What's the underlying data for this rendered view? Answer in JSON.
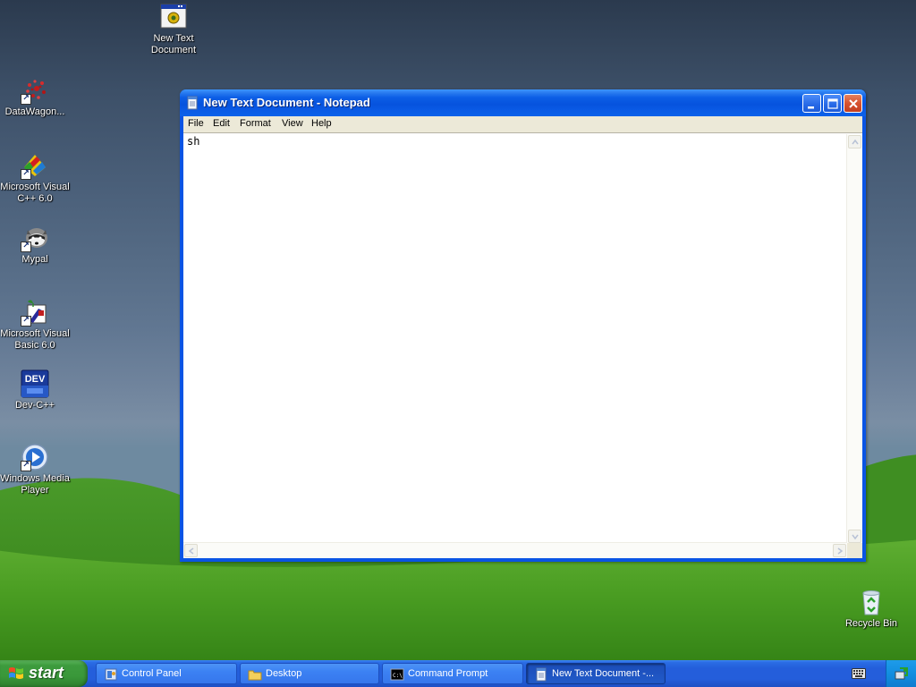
{
  "desktop": {
    "icons": [
      {
        "label": "New Text Document"
      },
      {
        "label": "DataWagon..."
      },
      {
        "label": "Microsoft Visual C++ 6.0"
      },
      {
        "label": "Mypal"
      },
      {
        "label": "Microsoft Visual Basic 6.0"
      },
      {
        "label": "Dev-C++"
      },
      {
        "label": "Windows Media Player"
      },
      {
        "label": "Recycle Bin"
      }
    ],
    "devcpp_icon_text": "DEV"
  },
  "notepad": {
    "title": "New Text Document - Notepad",
    "menu": [
      "File",
      "Edit",
      "Format",
      "View",
      "Help"
    ],
    "content": "sh"
  },
  "taskbar": {
    "start_label": "start",
    "tasks": [
      {
        "label": "Control Panel",
        "active": false
      },
      {
        "label": "Desktop",
        "active": false
      },
      {
        "label": "Command Prompt",
        "active": false
      },
      {
        "label": "New Text Document -...",
        "active": true
      }
    ],
    "cmd_icon_text": "C:\\"
  },
  "colors": {
    "title_bar": "#0a5be6",
    "taskbar": "#245edb",
    "start_button": "#3a983a",
    "tray": "#128ee0"
  }
}
